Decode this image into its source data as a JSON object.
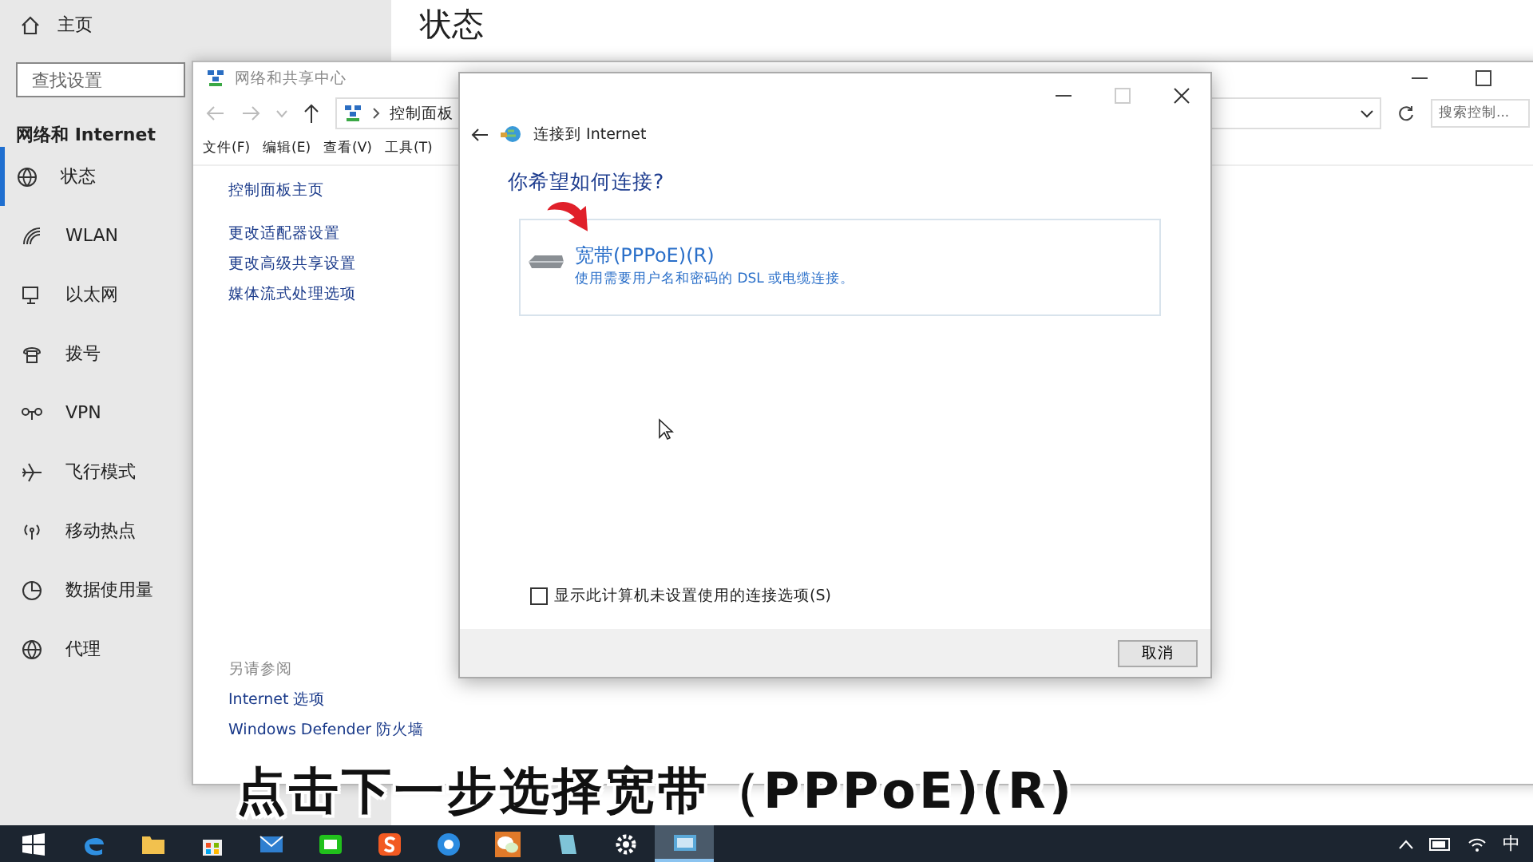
{
  "settings": {
    "home": "主页",
    "search": {
      "placeholder": "查找设置"
    },
    "section": "网络和 Internet",
    "page_title": "状态",
    "items": [
      {
        "label": "状态",
        "kind": "status",
        "selected": true
      },
      {
        "label": "WLAN",
        "kind": "wlan",
        "selected": false
      },
      {
        "label": "以太网",
        "kind": "ethernet",
        "selected": false
      },
      {
        "label": "拨号",
        "kind": "dialup",
        "selected": false
      },
      {
        "label": "VPN",
        "kind": "vpn",
        "selected": false
      },
      {
        "label": "飞行模式",
        "kind": "airplane",
        "selected": false
      },
      {
        "label": "移动热点",
        "kind": "hotspot",
        "selected": false
      },
      {
        "label": "数据使用量",
        "kind": "data",
        "selected": false
      },
      {
        "label": "代理",
        "kind": "proxy",
        "selected": false
      }
    ]
  },
  "network_window": {
    "title": "网络和共享中心",
    "breadcrumb": [
      "控制面板"
    ],
    "search": {
      "placeholder": "搜索控制..."
    },
    "menu": [
      "文件(F)",
      "编辑(E)",
      "查看(V)",
      "工具(T)"
    ],
    "links": [
      "控制面板主页",
      "更改适配器设置",
      "更改高级共享设置",
      "媒体流式处理选项"
    ],
    "see_also": {
      "heading": "另请参阅",
      "links": [
        "Internet 选项",
        "Windows Defender 防火墙"
      ]
    }
  },
  "dialog": {
    "title": "连接到 Internet",
    "question": "你希望如何连接?",
    "options": [
      {
        "title": "宽带(PPPoE)(R)",
        "description": "使用需要用户名和密码的 DSL 或电缆连接。"
      }
    ],
    "show_unsetup": {
      "label": "显示此计算机未设置使用的连接选项(S)",
      "checked": false
    },
    "buttons": [
      "取消"
    ]
  },
  "caption": "点击下一步选择宽带（PPPoE)(R)",
  "taskbar": {
    "apps": [
      {
        "kind": "edge",
        "active": false
      },
      {
        "kind": "folder",
        "active": false
      },
      {
        "kind": "store",
        "active": false
      },
      {
        "kind": "mail",
        "active": false
      },
      {
        "kind": "tv",
        "active": false
      },
      {
        "kind": "sogou",
        "active": false
      },
      {
        "kind": "browser",
        "active": false
      },
      {
        "kind": "chat",
        "active": false
      },
      {
        "kind": "notepad",
        "active": false
      },
      {
        "kind": "gear",
        "active": false
      },
      {
        "kind": "network",
        "active": true
      }
    ],
    "ime": "中"
  }
}
